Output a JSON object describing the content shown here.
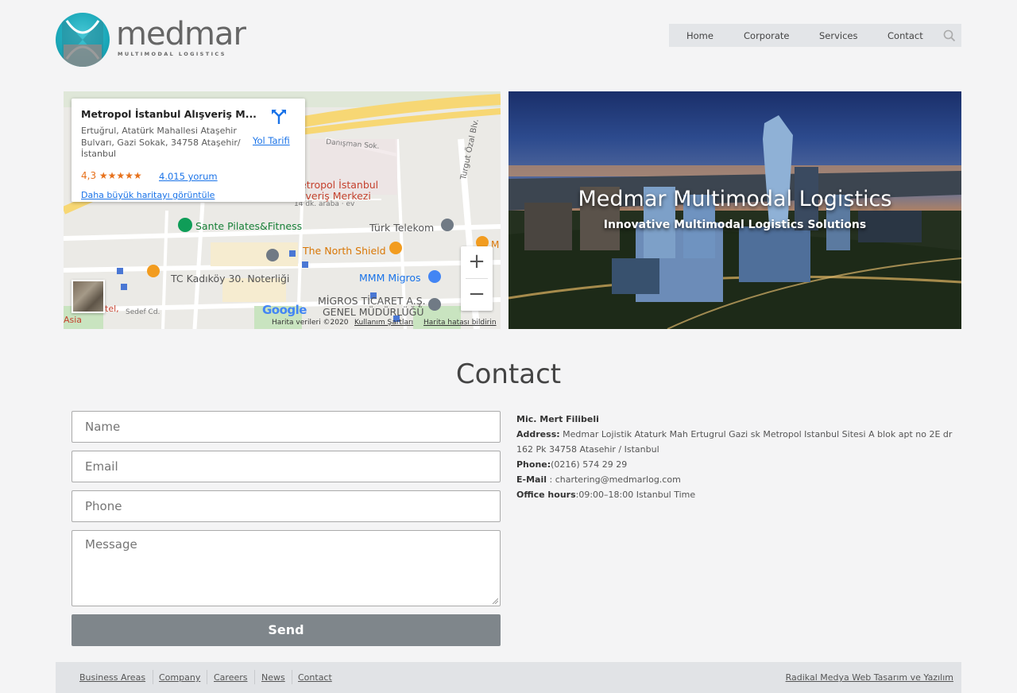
{
  "brand": {
    "name": "medmar",
    "tagline": "MULTIMODAL LOGISTICS"
  },
  "nav": {
    "home": "Home",
    "corporate": "Corporate",
    "services": "Services",
    "contact": "Contact",
    "search_icon": "search-icon"
  },
  "map": {
    "place_title": "Metropol İstanbul Alışveriş M...",
    "address": "Ertuğrul, Atatürk Mahallesi Ataşehir Bulvarı, Gazi Sokak, 34758 Ataşehir/İstanbul",
    "rating": "4,3 ★★★★★",
    "reviews": "4.015 yorum",
    "bigger_map": "Daha büyük haritayı görüntüle",
    "directions": "Yol Tarifi",
    "zoom_in": "+",
    "zoom_out": "−",
    "labels": {
      "danisman": "Danışman Sok.",
      "metropol": "etropol İstanbul",
      "alisveris": "şveriş Merkezi",
      "drive": "14 dk. araba · ev",
      "metropol_eren": "METROPOL EREN",
      "sante": "Sante Pilates&Fitness",
      "turk_telekom": "Türk Telekom",
      "north_shield": "The North Shield",
      "noterligi": "TC Kadıköy 30. Noterliği",
      "mmm_migros": "MMM Migros",
      "migros_ticaret": "MİGROS TİCARET A.Ş.",
      "genel_mudurlugu": "GENEL MÜDÜRLÜĞÜ",
      "turgut_ozal": "Turgut Özal Blv.",
      "sedef": "Sedef Cd.",
      "tel": "tel,",
      "asia": "Asia",
      "m": "M"
    },
    "google": "Google",
    "footer": {
      "data": "Harita verileri ©2020",
      "terms": "Kullanım Şartları",
      "report": "Harita hatası bildirin"
    }
  },
  "hero": {
    "title": "Medmar Multimodal Logistics",
    "subtitle": "Innovative Multimodal Logistics Solutions"
  },
  "contact": {
    "title": "Contact",
    "form": {
      "name_placeholder": "Name",
      "email_placeholder": "Email",
      "phone_placeholder": "Phone",
      "message_placeholder": "Message",
      "send": "Send"
    },
    "info": {
      "person": "Mic. Mert Filibeli",
      "address_label": "Address:",
      "address_value": " Medmar Lojistik Ataturk Mah Ertugrul Gazi sk Metropol Istanbul Sitesi A blok apt no 2E dr 162 Pk 34758 Atasehir / Istanbul",
      "phone_label": "Phone:",
      "phone_value": "(0216) 574 29 29",
      "email_label": "E-Mail",
      "email_value": " : chartering@medmarlog.com",
      "hours_label": "Office hours",
      "hours_value": ":09:00–18:00 Istanbul Time"
    }
  },
  "footer": {
    "links": [
      "Business Areas",
      "Company",
      "Careers",
      "News",
      "Contact"
    ],
    "credit": "Radikal Medya Web Tasarım ve Yazılım"
  }
}
